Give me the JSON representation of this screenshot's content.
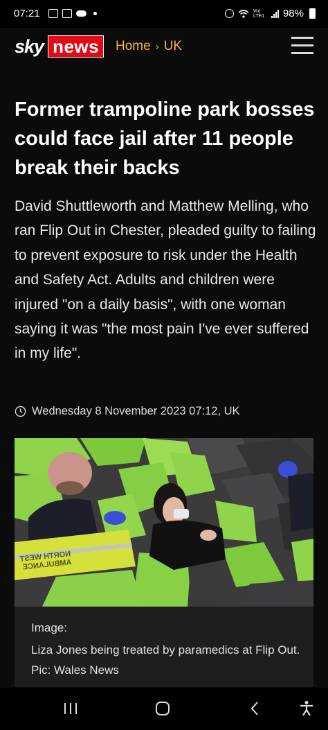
{
  "status_bar": {
    "time": "07:21",
    "network_label": "Vo) LTE1",
    "battery_percent": "98%"
  },
  "header": {
    "logo_sky": "sky",
    "logo_news": "news",
    "breadcrumb": [
      "Home",
      "UK"
    ],
    "menu_icon": "hamburger-menu-icon"
  },
  "article": {
    "headline": "Former trampoline park bosses could face jail after 11 people break their backs",
    "standfirst": "David Shuttleworth and Matthew Melling, who ran Flip Out in Chester, pleaded guilty to failing to prevent exposure to risk under the Health and Safety Act. Adults and children were injured \"on a daily basis\", with one woman saying it was \"the most pain I've ever suffered in my life\".",
    "timestamp": "Wednesday 8 November 2023 07:12, UK",
    "image_caption_label": "Image:",
    "image_caption": "Liza Jones being treated by paramedics at Flip Out. Pic: Wales News",
    "bag_text": [
      "NORTH WEST",
      "AMBULANCE"
    ]
  },
  "nav_bar": [
    "recent-apps-icon",
    "home-icon",
    "back-icon",
    "accessibility-icon"
  ],
  "colors": {
    "brand_red": "#e10a16",
    "breadcrumb_yellow": "#f6b731",
    "background": "#0b0b0b",
    "foam_green": "#8fd44a"
  }
}
